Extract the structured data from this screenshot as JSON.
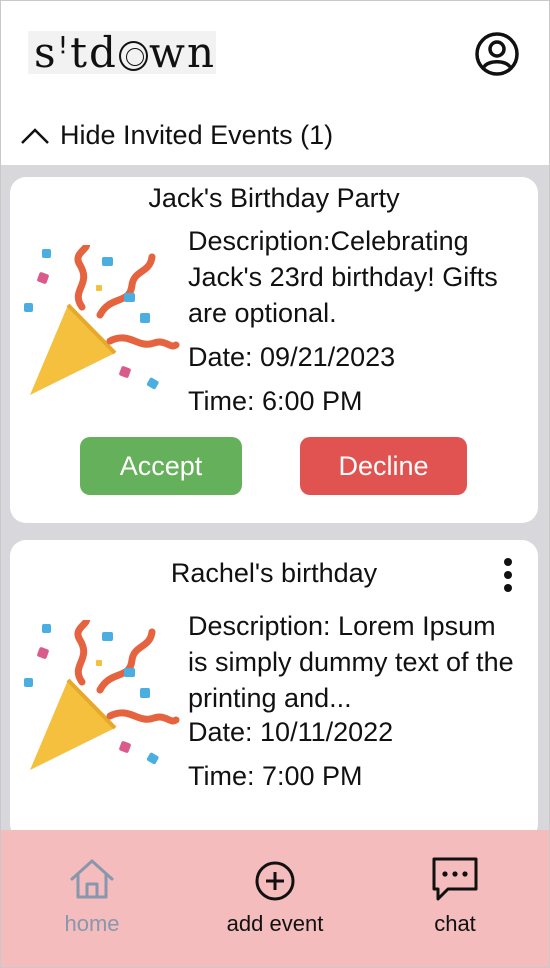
{
  "app": {
    "logo_text": "sitdown"
  },
  "header": {
    "toggle_label": "Hide Invited Events (1)",
    "profile_icon": "user-circle-icon"
  },
  "events": [
    {
      "title": "Jack's Birthday Party",
      "description": "Description:Celebrating Jack's 23rd birthday! Gifts are optional.",
      "date": "Date: 09/21/2023",
      "time": "Time: 6:00 PM",
      "accept_label": "Accept",
      "decline_label": "Decline",
      "icon": "party-popper-icon"
    },
    {
      "title": "Rachel's birthday",
      "description": "Description: Lorem Ipsum is simply dummy text of the printing and...",
      "date": "Date: 10/11/2022",
      "time": "Time: 7:00 PM",
      "menu_icon": "kebab-menu-icon",
      "icon": "party-popper-icon"
    }
  ],
  "nav": {
    "home_label": "home",
    "add_label": "add event",
    "chat_label": "chat"
  },
  "colors": {
    "accept": "#65b05b",
    "decline": "#e05350",
    "nav_bg": "#f4bcbc",
    "list_bg": "#d7d7dc",
    "home_active": "#8897ad"
  }
}
